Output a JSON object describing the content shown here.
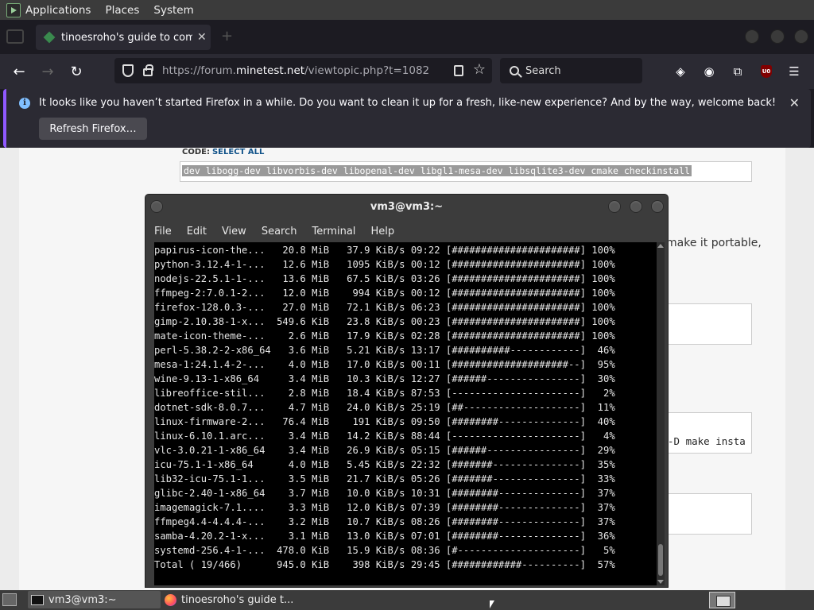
{
  "top_panel": {
    "menus": [
      "Applications",
      "Places",
      "System"
    ]
  },
  "browser": {
    "tab_title": "tinoesroho's guide to compiling",
    "url_host": "https://forum.",
    "url_domain": "minetest.net",
    "url_path": "/viewtopic.php?t=1082",
    "search_placeholder": "Search",
    "ublock_badge": "U0",
    "notification": {
      "text": "It looks like you haven’t started Firefox in a while. Do you want to clean it up for a fresh, like-new experience? And by the way, welcome back!",
      "button": "Refresh Firefox…"
    }
  },
  "page": {
    "code_label": "CODE:",
    "select_all": "SELECT ALL",
    "code_line": "dev libogg-dev libvorbis-dev libopenal-dev libgl1-mesa-dev libsqlite3-dev cmake checkinstall",
    "side_text": "make it portable,",
    "box_code": "-D make insta"
  },
  "terminal": {
    "title": "vm3@vm3:~",
    "menus": [
      "File",
      "Edit",
      "View",
      "Search",
      "Terminal",
      "Help"
    ],
    "rows": [
      [
        "papirus-icon-the...",
        "20.8",
        "37.9",
        "09:22",
        "######################",
        "100%"
      ],
      [
        "python-3.12.4-1-...",
        "12.6",
        "1095",
        "00:12",
        "######################",
        "100%"
      ],
      [
        "nodejs-22.5.1-1-...",
        "13.6",
        "67.5",
        "03:26",
        "######################",
        "100%"
      ],
      [
        "ffmpeg-2:7.0.1-2...",
        "12.0",
        "994",
        "00:12",
        "######################",
        "100%"
      ],
      [
        "firefox-128.0.3-...",
        "27.0",
        "72.1",
        "06:23",
        "######################",
        "100%"
      ],
      [
        "gimp-2.10.38-1-x...",
        "549.6 KiB",
        "23.8",
        "00:23",
        "######################",
        "100%"
      ],
      [
        "mate-icon-theme-...",
        "2.6",
        "17.9",
        "02:28",
        "######################",
        "100%"
      ],
      [
        "perl-5.38.2-2-x86_64",
        "3.6",
        "5.21",
        "13:17",
        "##########------------",
        "46%"
      ],
      [
        "mesa-1:24.1.4-2-...",
        "4.0",
        "17.0",
        "00:11",
        "####################--",
        "95%"
      ],
      [
        "wine-9.13-1-x86_64",
        "3.4",
        "10.3",
        "12:27",
        "######----------------",
        "30%"
      ],
      [
        "libreoffice-stil...",
        "2.8",
        "18.4",
        "87:53",
        "----------------------",
        "2%"
      ],
      [
        "dotnet-sdk-8.0.7...",
        "4.7",
        "24.0",
        "25:19",
        "##--------------------",
        "11%"
      ],
      [
        "linux-firmware-2...",
        "76.4",
        "191",
        "09:50",
        "########--------------",
        "40%"
      ],
      [
        "linux-6.10.1.arc...",
        "3.4",
        "14.2",
        "88:44",
        "----------------------",
        "4%"
      ],
      [
        "vlc-3.0.21-1-x86_64",
        "3.4",
        "26.9",
        "05:15",
        "######----------------",
        "29%"
      ],
      [
        "icu-75.1-1-x86_64",
        "4.0",
        "5.45",
        "22:32",
        "#######---------------",
        "35%"
      ],
      [
        "lib32-icu-75.1-1...",
        "3.5",
        "21.7",
        "05:26",
        "#######---------------",
        "33%"
      ],
      [
        "glibc-2.40-1-x86_64",
        "3.7",
        "10.0",
        "10:31",
        "########--------------",
        "37%"
      ],
      [
        "imagemagick-7.1....",
        "3.3",
        "12.0",
        "07:39",
        "########--------------",
        "37%"
      ],
      [
        "ffmpeg4.4-4.4.4-...",
        "3.2",
        "10.7",
        "08:26",
        "########--------------",
        "37%"
      ],
      [
        "samba-4.20.2-1-x...",
        "3.1",
        "13.0",
        "07:01",
        "########--------------",
        "36%"
      ],
      [
        "systemd-256.4-1-...",
        "478.0 KiB",
        "15.9",
        "08:36",
        "#---------------------",
        "5%"
      ],
      [
        "Total ( 19/466)",
        "945.0 KiB",
        "398",
        "29:45",
        "############----------",
        "57%"
      ]
    ]
  },
  "taskbar": {
    "tasks": [
      "vm3@vm3:~",
      "tinoesroho's guide t..."
    ]
  }
}
